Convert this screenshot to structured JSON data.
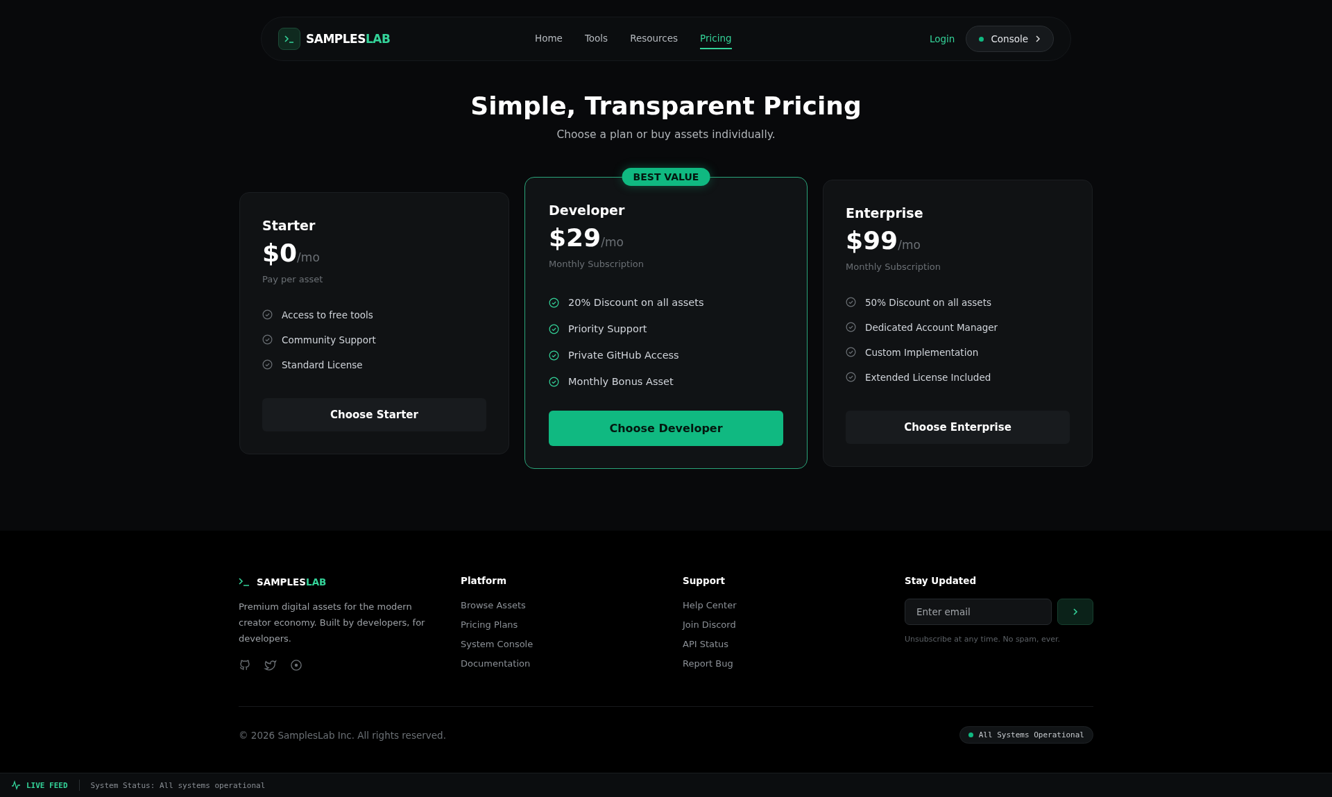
{
  "nav": {
    "brand": {
      "main": "SAMPLES",
      "accent": "LAB"
    },
    "links": [
      {
        "label": "Home",
        "selected": false
      },
      {
        "label": "Tools",
        "selected": false
      },
      {
        "label": "Resources",
        "selected": false
      },
      {
        "label": "Pricing",
        "selected": true
      }
    ],
    "login": "Login",
    "console": "Console"
  },
  "hero": {
    "title": "Simple, Transparent Pricing",
    "subtitle": "Choose a plan or buy assets individually."
  },
  "plans": [
    {
      "name": "Starter",
      "price": "$0",
      "period": "/mo",
      "note": "Pay per asset",
      "featured": false,
      "features": [
        "Access to free tools",
        "Community Support",
        "Standard License"
      ],
      "cta": "Choose Starter"
    },
    {
      "name": "Developer",
      "price": "$29",
      "period": "/mo",
      "note": "Monthly Subscription",
      "featured": true,
      "badge": "BEST VALUE",
      "features": [
        "20% Discount on all assets",
        "Priority Support",
        "Private GitHub Access",
        "Monthly Bonus Asset"
      ],
      "cta": "Choose Developer"
    },
    {
      "name": "Enterprise",
      "price": "$99",
      "period": "/mo",
      "note": "Monthly Subscription",
      "featured": false,
      "features": [
        "50% Discount on all assets",
        "Dedicated Account Manager",
        "Custom Implementation",
        "Extended License Included"
      ],
      "cta": "Choose Enterprise"
    }
  ],
  "footer": {
    "brand": {
      "main": "SAMPLES",
      "accent": "LAB"
    },
    "description": "Premium digital assets for the modern creator economy. Built by developers, for developers.",
    "columns": [
      {
        "title": "Platform",
        "links": [
          "Browse Assets",
          "Pricing Plans",
          "System Console",
          "Documentation"
        ]
      },
      {
        "title": "Support",
        "links": [
          "Help Center",
          "Join Discord",
          "API Status",
          "Report Bug"
        ]
      }
    ],
    "newsletter": {
      "title": "Stay Updated",
      "placeholder": "Enter email",
      "note": "Unsubscribe at any time. No spam, ever."
    },
    "copyright": "© 2026 SamplesLab Inc. All rights reserved.",
    "status": "All Systems Operational"
  },
  "status_bar": {
    "label": "LIVE FEED",
    "message": "System Status: All systems operational"
  }
}
